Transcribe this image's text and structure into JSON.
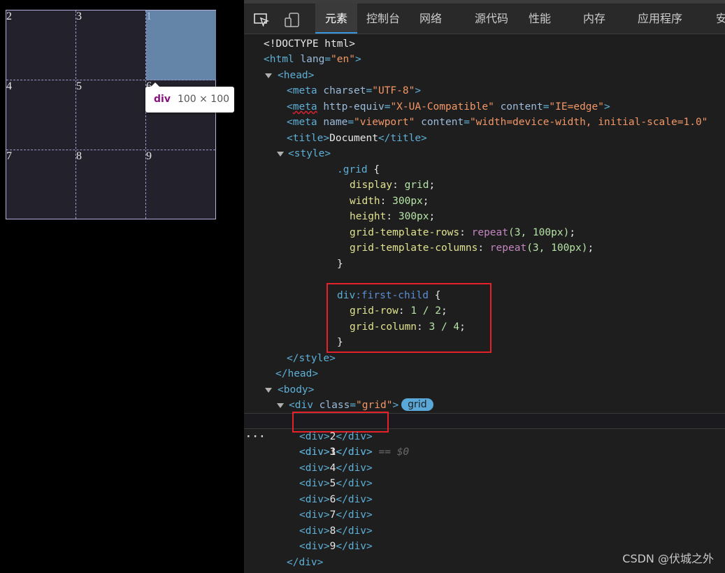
{
  "viewport": {
    "cells": [
      "2",
      "3",
      "1",
      "4",
      "5",
      "6",
      "7",
      "8",
      "9"
    ],
    "tooltip": {
      "tag": "div",
      "dimensions": "100 × 100"
    }
  },
  "devtools": {
    "tabs": [
      "元素",
      "控制台",
      "网络",
      "源代码",
      "性能",
      "内存",
      "应用程序",
      "安"
    ],
    "active_tab": "元素",
    "dom": {
      "doctype": "<!DOCTYPE html>",
      "html_open": "html",
      "html_lang_attr": "lang",
      "html_lang_val": "\"en\"",
      "head": "head",
      "meta1_attr": "charset",
      "meta1_val": "\"UTF-8\"",
      "meta2_attr1": "http-equiv",
      "meta2_val1": "\"X-UA-Compatible\"",
      "meta2_attr2": "content",
      "meta2_val2": "\"IE=edge\"",
      "meta3_attr1": "name",
      "meta3_val1": "\"viewport\"",
      "meta3_attr2": "content",
      "meta3_val2": "\"width=device-width, initial-scale=1.0\"",
      "title_text": "Document",
      "style": "style",
      "css": {
        "grid_selector": ".grid",
        "display_prop": "display",
        "display_val": "grid",
        "width_prop": "width",
        "width_val": "300px",
        "height_prop": "height",
        "height_val": "300px",
        "rows_prop": "grid-template-rows",
        "rows_fn": "repeat",
        "rows_args": "(3, 100px)",
        "cols_prop": "grid-template-columns",
        "cols_fn": "repeat",
        "cols_args": "(3, 100px)",
        "div_selector": "div",
        "div_pseudo": ":first-child",
        "row_prop": "grid-row",
        "row_val": "1 / 2",
        "col_prop": "grid-column",
        "col_val": "3 / 4"
      },
      "body": "body",
      "grid_div_class_val": "\"grid\"",
      "grid_badge": "grid",
      "dollar": "== $0",
      "children": [
        "1",
        "2",
        "3",
        "4",
        "5",
        "6",
        "7",
        "8",
        "9"
      ]
    }
  },
  "watermark": "CSDN @伏城之外"
}
